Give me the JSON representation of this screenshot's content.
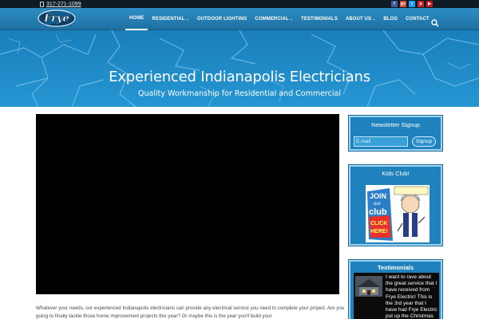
{
  "topbar": {
    "phone": "317-271-1099",
    "social_icons": [
      {
        "icon": "facebook-icon",
        "glyph": "f",
        "color": "#3b5998"
      },
      {
        "icon": "google-plus-icon",
        "glyph": "g+",
        "color": "#dd4b39"
      },
      {
        "icon": "twitter-icon",
        "glyph": "t",
        "color": "#1da1f2"
      },
      {
        "icon": "pinterest-icon",
        "glyph": "p",
        "color": "#cb2027"
      },
      {
        "icon": "youtube-icon",
        "glyph": "▶",
        "color": "#cc181e"
      }
    ]
  },
  "brand": {
    "logo_text": "Frye"
  },
  "nav": {
    "items": [
      {
        "label": "HOME",
        "active": true,
        "dropdown": false
      },
      {
        "label": "RESIDENTIAL",
        "active": false,
        "dropdown": true
      },
      {
        "label": "OUTDOOR LIGHTING",
        "active": false,
        "dropdown": false
      },
      {
        "label": "COMMERCIAL",
        "active": false,
        "dropdown": true
      },
      {
        "label": "TESTIMONIALS",
        "active": false,
        "dropdown": false
      },
      {
        "label": "ABOUT US",
        "active": false,
        "dropdown": true
      },
      {
        "label": "BLOG",
        "active": false,
        "dropdown": false
      },
      {
        "label": "CONTACT",
        "active": false,
        "dropdown": false
      }
    ],
    "search_icon": "search-icon"
  },
  "hero": {
    "title": "Experienced Indianapolis Electricians",
    "subtitle": "Quality Workmanship for Residential and Commercial"
  },
  "main": {
    "body_text": "Whatever your needs, our experienced Indianapolis electricians can provide any electrical service you need to complete your project. Are you going to finally tackle those home improvement projects this year? Or maybe this is the year you'll build your"
  },
  "sidebar": {
    "newsletter": {
      "title": "Newsletter Signup",
      "email_placeholder": "E-mail",
      "button_label": "Signup"
    },
    "kids": {
      "title": "Kids Club!",
      "badge": [
        "JOIN",
        "our",
        "club",
        "CLICK",
        "HERE!"
      ]
    },
    "testimonials": {
      "title": "Testimonials",
      "quote": "I want to rave about the great service that I have received from Frye Electric! This is the 3rd year that I have had Frye Electric put up the Christmas"
    }
  },
  "colors": {
    "brand_blue": "#1d86c3",
    "nav_blue": "#2d8ec4",
    "topbar": "#0e1a24"
  }
}
